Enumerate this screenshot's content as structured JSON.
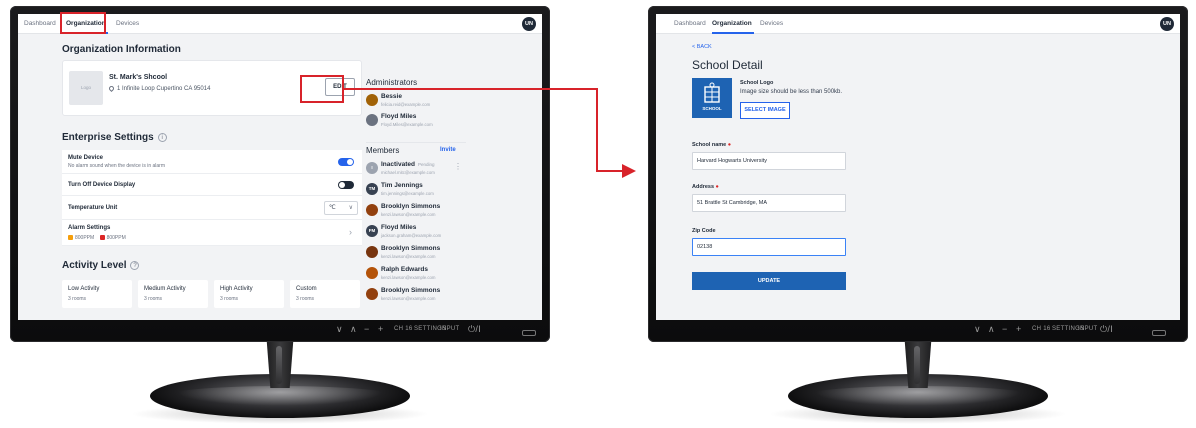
{
  "left_screen": {
    "nav": {
      "dashboard": "Dashboard",
      "organization": "Organization",
      "devices": "Devices"
    },
    "avatar_initials": "UN",
    "org_heading": "Organization Information",
    "logo_placeholder": "Logo",
    "school_name": "St. Mark's Shcool",
    "address": "1 Infinite Loop Cupertino CA 95014",
    "edit_label": "EDIT",
    "enterprise_heading": "Enterprise Settings",
    "settings": {
      "mute_label": "Mute Device",
      "mute_sub": "No alarm sound when the device is in alarm",
      "turnoff_label": "Turn Off Device Display",
      "temp_label": "Temperature Unit",
      "temp_value": "℃",
      "alarm_label": "Alarm Settings",
      "alarm_low": "800PPM",
      "alarm_high": "800PPM"
    },
    "activity_heading": "Activity Level",
    "activity": [
      {
        "label": "Low Activity",
        "sub": "3 rooms"
      },
      {
        "label": "Medium Activity",
        "sub": "3 rooms"
      },
      {
        "label": "High Activity",
        "sub": "3 rooms"
      },
      {
        "label": "Custom",
        "sub": "3 rooms"
      }
    ],
    "admins_heading": "Administrators",
    "admins": [
      {
        "name": "Bessie",
        "email": "felicia.reid@example.com"
      },
      {
        "name": "Floyd Miles",
        "email": "Floyd.Miles@example.com"
      }
    ],
    "members_heading": "Members",
    "invite_label": "Invite",
    "members": [
      {
        "initials": "I",
        "name": "Inactivated",
        "status": "Pending",
        "email": "michael.mitc@example.com"
      },
      {
        "initials": "TM",
        "name": "Tim Jennings",
        "status": "",
        "email": "tim.jennings@example.com"
      },
      {
        "initials": "",
        "name": "Brooklyn Simmons",
        "status": "",
        "email": "kenzi.lawson@example.com"
      },
      {
        "initials": "FM",
        "name": "Floyd Miles",
        "status": "",
        "email": "jackson.graham@example.com"
      },
      {
        "initials": "",
        "name": "Brooklyn Simmons",
        "status": "",
        "email": "kenzi.lawson@example.com"
      },
      {
        "initials": "",
        "name": "Ralph Edwards",
        "status": "",
        "email": "kenzi.lawson@example.com"
      },
      {
        "initials": "",
        "name": "Brooklyn Simmons",
        "status": "",
        "email": "kenzi.lawson@example.com"
      }
    ]
  },
  "right_screen": {
    "nav": {
      "dashboard": "Dashboard",
      "organization": "Organization",
      "devices": "Devices"
    },
    "avatar_initials": "UN",
    "back_label": "< BACK",
    "title": "School Detail",
    "logo_label": "School Logo",
    "logo_hint": "Image size should be less than 500kb.",
    "logo_caption": "SCHOOL",
    "select_image": "SELECT IMAGE",
    "fields": {
      "name_label": "School name",
      "name_value": "Harvard Hogwarts University",
      "address_label": "Address",
      "address_value": "51 Brattle St Cambridge, MA",
      "zip_label": "Zip Code",
      "zip_value": "02138"
    },
    "update_label": "UPDATE"
  },
  "monitor_controls": {
    "down": "∨",
    "up": "∧",
    "minus": "−",
    "plus": "+",
    "ch": "CH 16",
    "settings": "SETTINGS",
    "input": "INPUT",
    "power": "⏻/I"
  },
  "colors": {
    "accent": "#2563eb",
    "highlight": "#d8232a",
    "brand_blue": "#1e63b3"
  }
}
